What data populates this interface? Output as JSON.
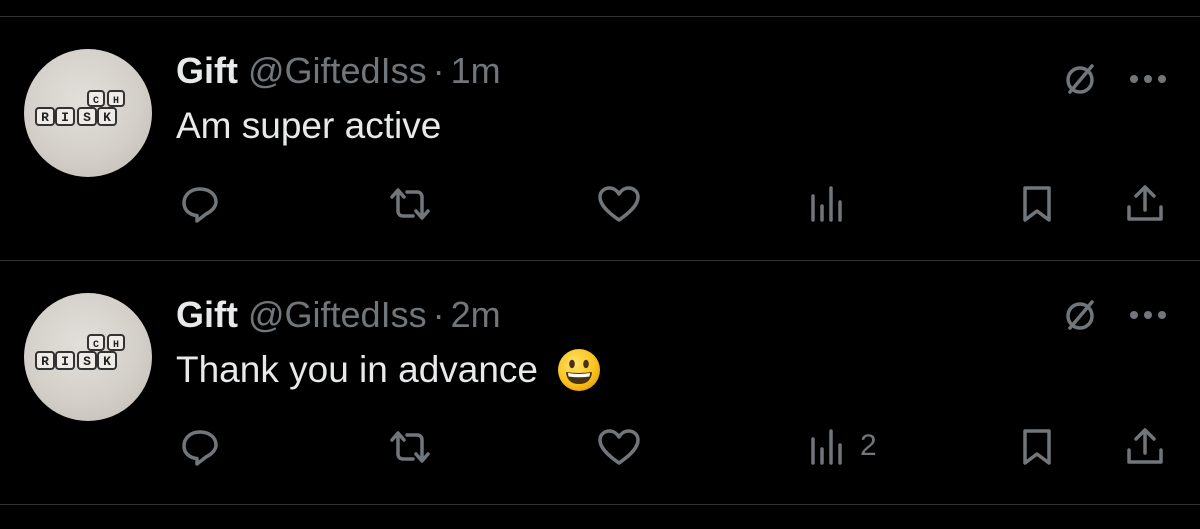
{
  "tweets": [
    {
      "display_name": "Gift",
      "handle": "@GiftedIss",
      "separator": "·",
      "time": "1m",
      "text": "Am super active",
      "emoji": "",
      "views_count": ""
    },
    {
      "display_name": "Gift",
      "handle": "@GiftedIss",
      "separator": "·",
      "time": "2m",
      "text": "Thank you in advance",
      "emoji": "grinning-face",
      "views_count": "2"
    }
  ],
  "avatar": {
    "row1": [
      "R",
      "I",
      "S",
      "K"
    ],
    "row2": [
      "C",
      "H"
    ]
  },
  "icons": {
    "grok": "grok-icon",
    "more": "more-icon",
    "reply": "reply-icon",
    "retweet": "retweet-icon",
    "like": "like-icon",
    "views": "views-icon",
    "bookmark": "bookmark-icon",
    "share": "share-icon"
  },
  "colors": {
    "background": "#000000",
    "text": "#e7e9ea",
    "secondary": "#71767b",
    "divider": "#2f3336"
  }
}
